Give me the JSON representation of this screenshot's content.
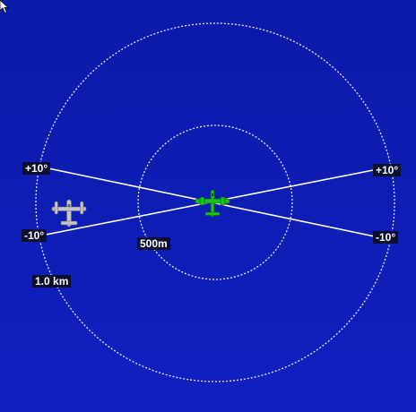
{
  "range_rings": [
    {
      "label": "500m"
    },
    {
      "label": "1.0 km"
    }
  ],
  "angle_markers": {
    "left_upper": "+10°",
    "left_lower": "-10°",
    "right_upper": "+10°",
    "right_lower": "-10°"
  },
  "aircraft": {
    "own": {
      "icon": "own-aircraft-icon",
      "color": "#19c219"
    },
    "target": {
      "icon": "target-aircraft-icon",
      "color": "#bfbfbf"
    }
  },
  "colors": {
    "background": "#0d1cb0",
    "ring": "#e6e6ff",
    "label_bg": "#0a0f2e"
  }
}
